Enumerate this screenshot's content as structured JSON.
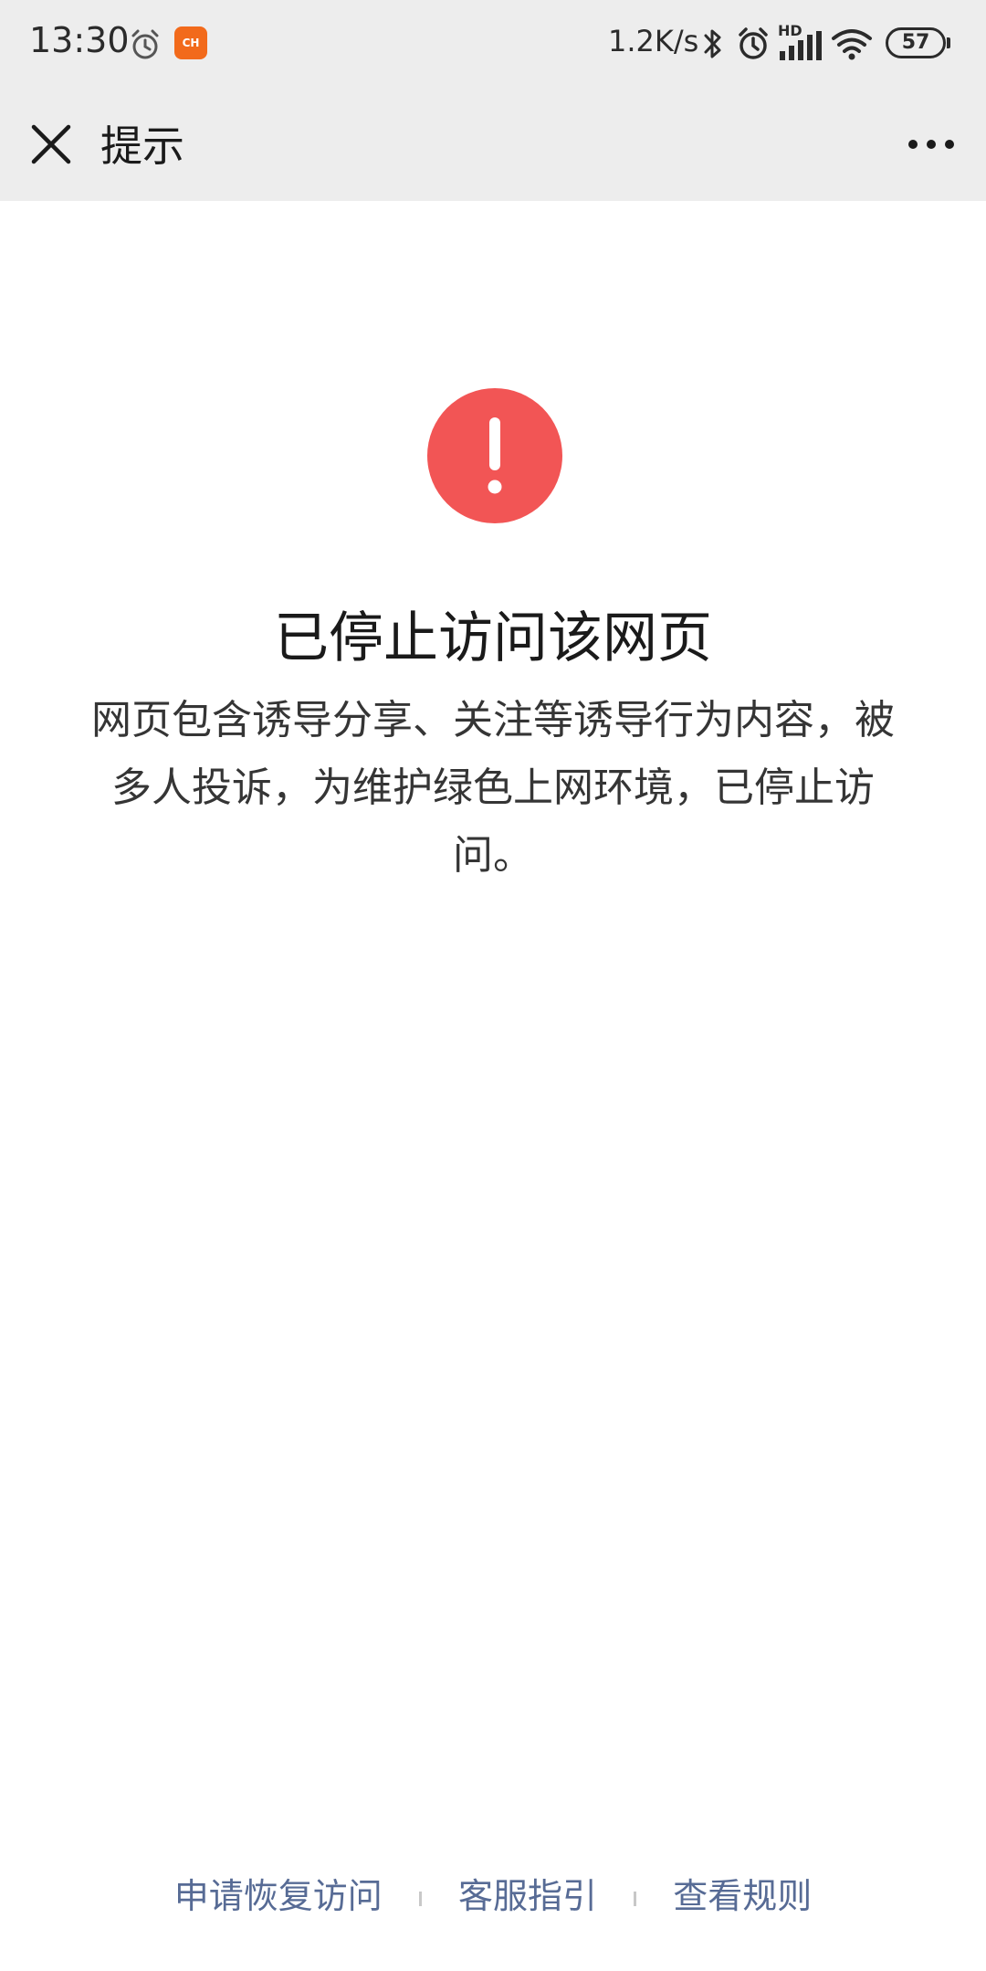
{
  "status_bar": {
    "time": "13:30",
    "app_badge_text": "CH",
    "network_speed": "1.2K/s",
    "hd_label": "HD",
    "battery_level": "57",
    "icons": [
      "alarm-icon",
      "app-notification-icon",
      "bluetooth-icon",
      "alarm-icon",
      "signal-icon",
      "wifi-icon",
      "battery-icon"
    ]
  },
  "nav": {
    "title": "提示",
    "close_icon": "close-icon",
    "more_icon": "more-icon"
  },
  "content": {
    "icon": "warning-icon",
    "icon_color": "#f25555",
    "headline": "已停止访问该网页",
    "description": "网页包含诱导分享、关注等诱导行为内容，被多人投诉，为维护绿色上网环境，已停止访问。"
  },
  "footer": {
    "links": [
      "申请恢复访问",
      "客服指引",
      "查看规则"
    ],
    "link_color": "#576b95"
  }
}
